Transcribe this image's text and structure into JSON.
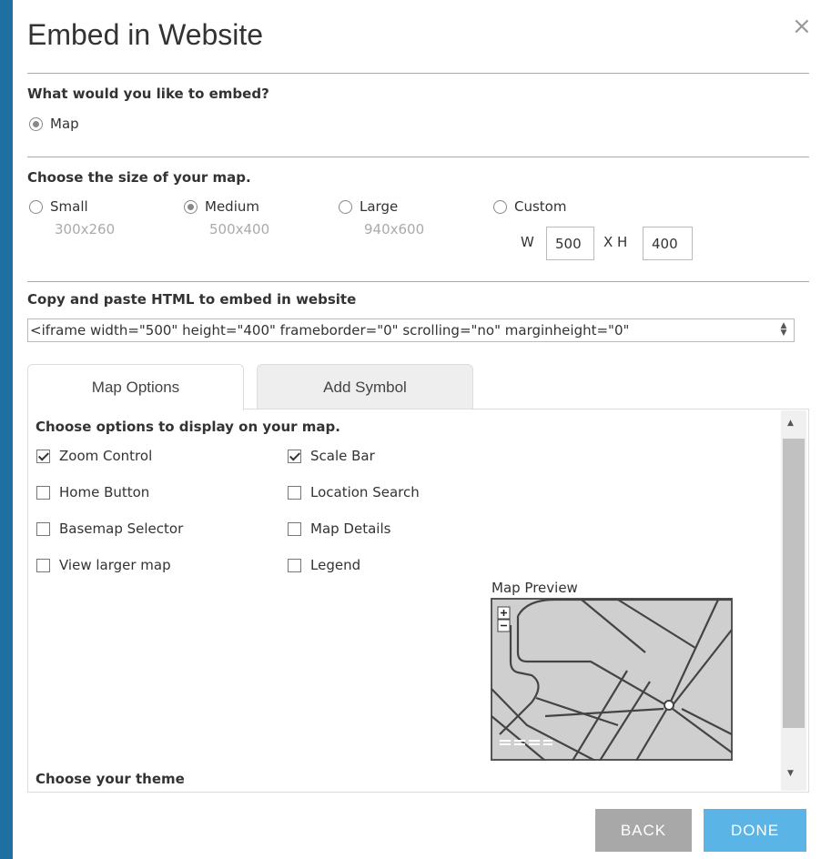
{
  "dialog": {
    "title": "Embed in Website",
    "close_glyph": "×"
  },
  "embed_type": {
    "heading": "What would you like to embed?",
    "options": [
      {
        "label": "Map",
        "selected": true
      }
    ]
  },
  "size": {
    "heading": "Choose the size of your map.",
    "options": [
      {
        "label": "Small",
        "dims": "300x260",
        "selected": false
      },
      {
        "label": "Medium",
        "dims": "500x400",
        "selected": true
      },
      {
        "label": "Large",
        "dims": "940x600",
        "selected": false
      },
      {
        "label": "Custom",
        "selected": false
      }
    ],
    "custom": {
      "w_label": "W",
      "w_value": "500",
      "x_label": "X H",
      "h_value": "400"
    }
  },
  "html_code": {
    "heading": "Copy and paste HTML to embed in website",
    "value": "<iframe width=\"500\" height=\"400\" frameborder=\"0\" scrolling=\"no\" marginheight=\"0\""
  },
  "tabs": [
    {
      "label": "Map Options",
      "active": true
    },
    {
      "label": "Add Symbol",
      "active": false
    }
  ],
  "map_options": {
    "heading": "Choose options to display on your map.",
    "left": [
      {
        "label": "Zoom Control",
        "checked": true
      },
      {
        "label": "Home Button",
        "checked": false
      },
      {
        "label": "Basemap Selector",
        "checked": false
      },
      {
        "label": "View larger map",
        "checked": false
      }
    ],
    "right": [
      {
        "label": "Scale Bar",
        "checked": true
      },
      {
        "label": "Location Search",
        "checked": false
      },
      {
        "label": "Map Details",
        "checked": false
      },
      {
        "label": "Legend",
        "checked": false
      }
    ],
    "preview_label": "Map Preview",
    "theme_heading": "Choose your theme"
  },
  "buttons": {
    "back": "BACK",
    "done": "DONE"
  },
  "colors": {
    "background": "#1f6fa3",
    "back_button": "#a8a8a8",
    "done_button": "#5ab4e5"
  }
}
